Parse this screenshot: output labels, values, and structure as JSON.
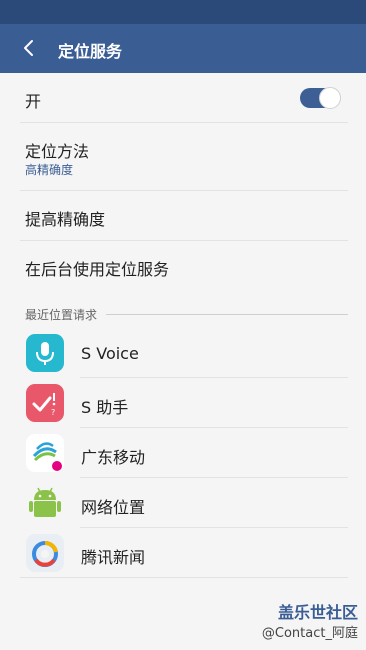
{
  "appbar": {
    "title": "定位服务"
  },
  "switch_row": {
    "label": "开",
    "toggle_on": true
  },
  "method": {
    "label": "定位方法",
    "value": "高精确度"
  },
  "improve": {
    "label": "提高精确度"
  },
  "background": {
    "label": "在后台使用定位服务"
  },
  "recent": {
    "header": "最近位置请求",
    "apps": [
      {
        "name": "S Voice",
        "icon": "s-voice-mic-icon",
        "color": "#25b8cf"
      },
      {
        "name": "S 助手",
        "icon": "s-assistant-icon",
        "color": "#e8576a"
      },
      {
        "name": "广东移动",
        "icon": "china-mobile-icon",
        "color": "#2aa3d9"
      },
      {
        "name": "网络位置",
        "icon": "android-robot-icon",
        "color": "#8bc34a"
      },
      {
        "name": "腾讯新闻",
        "icon": "tencent-news-icon",
        "color": "#3b8be0"
      }
    ]
  },
  "watermark": {
    "line1": "盖乐世社区",
    "line2": "@Contact_阿庭"
  }
}
